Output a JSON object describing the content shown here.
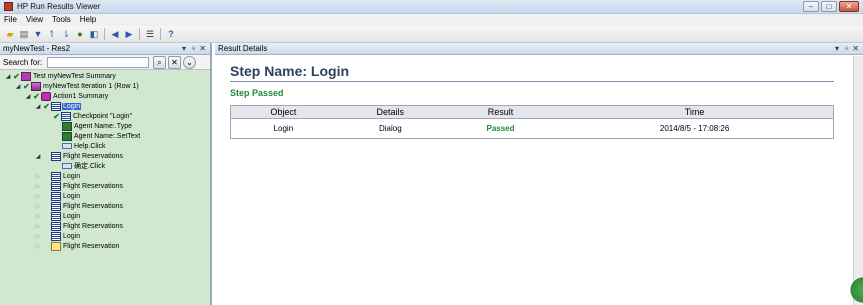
{
  "window": {
    "title": "HP Run Results Viewer"
  },
  "menu": [
    "File",
    "View",
    "Tools",
    "Help"
  ],
  "left_pane": {
    "title": "myNewTest - Res2",
    "search_label": "Search for:",
    "search_value": ""
  },
  "tree": [
    {
      "label": "Test myNewTest Summary"
    },
    {
      "label": "myNewTest Iteration 1 (Row 1)"
    },
    {
      "label": "Action1 Summary"
    },
    {
      "label": "Login"
    },
    {
      "label": "Checkpoint \"Login\""
    },
    {
      "label": "Agent Name:.Type"
    },
    {
      "label": "Agent Name:.SetText"
    },
    {
      "label": "Help.Click"
    },
    {
      "label": "Flight Reservations"
    },
    {
      "label": "确定.Click"
    },
    {
      "label": "Login"
    },
    {
      "label": "Flight Reservations"
    },
    {
      "label": "Login"
    },
    {
      "label": "Flight Reservations"
    },
    {
      "label": "Login"
    },
    {
      "label": "Flight Reservations"
    },
    {
      "label": "Login"
    },
    {
      "label": "Flight Reservation"
    }
  ],
  "right_pane": {
    "title": "Result Details",
    "step_name": "Step Name: Login",
    "status": "Step Passed",
    "columns": [
      "Object",
      "Details",
      "Result",
      "Time"
    ],
    "rows": [
      {
        "object": "Login",
        "details": "Dialog",
        "result": "Passed",
        "time": "2014/8/5 - 17:08:26"
      }
    ]
  },
  "colors": {
    "pane_bg": "#cfe8cf",
    "pass_green": "#1f8a3a",
    "step_title": "#2f3f62",
    "selection": "#3366cc"
  }
}
